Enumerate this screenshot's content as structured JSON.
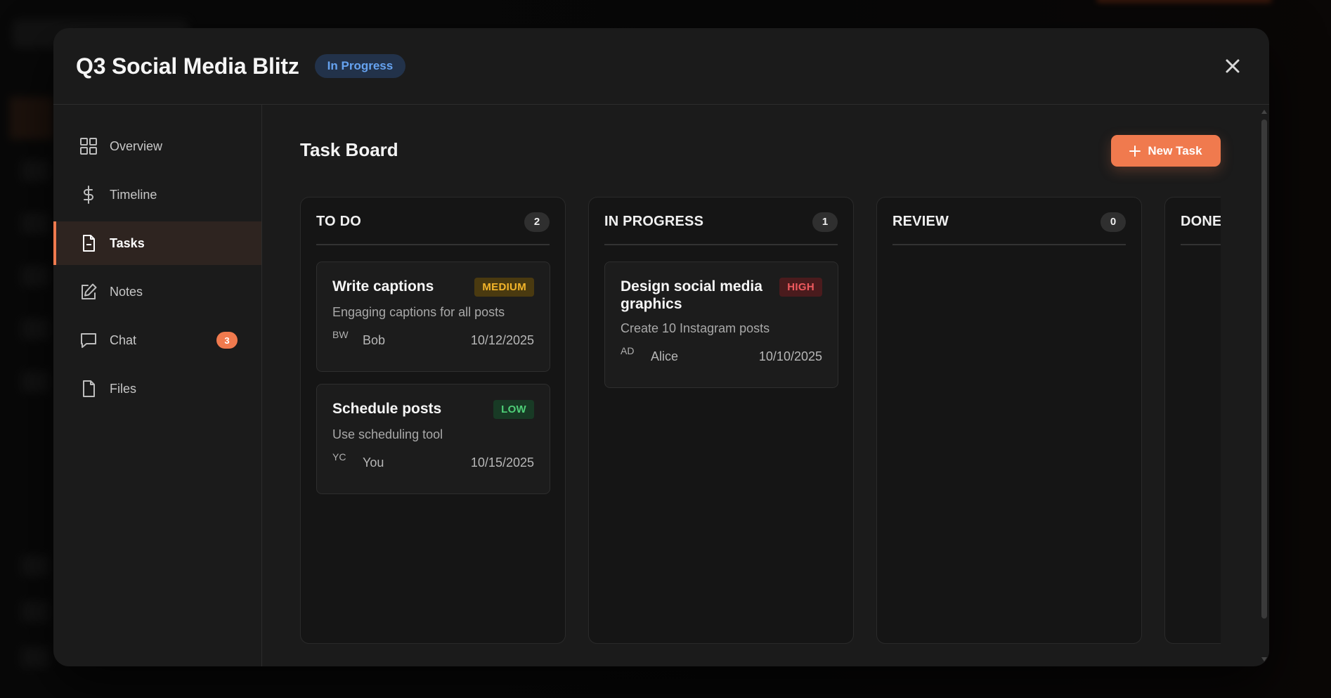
{
  "modal": {
    "title": "Q3 Social Media Blitz",
    "status": "In Progress",
    "close_icon": "close-icon"
  },
  "sidebar": {
    "items": [
      {
        "id": "overview",
        "label": "Overview",
        "icon": "grid-icon"
      },
      {
        "id": "timeline",
        "label": "Timeline",
        "icon": "dollar-icon"
      },
      {
        "id": "tasks",
        "label": "Tasks",
        "icon": "document-icon",
        "active": true
      },
      {
        "id": "notes",
        "label": "Notes",
        "icon": "edit-icon"
      },
      {
        "id": "chat",
        "label": "Chat",
        "icon": "chat-icon",
        "badge": "3"
      },
      {
        "id": "files",
        "label": "Files",
        "icon": "file-icon"
      }
    ]
  },
  "board": {
    "title": "Task Board",
    "new_task_label": "New Task",
    "columns": [
      {
        "title": "TO DO",
        "count": "2",
        "cards": [
          {
            "title": "Write captions",
            "priority": "MEDIUM",
            "description": "Engaging captions for all posts",
            "avatar": "BW",
            "assignee": "Bob",
            "due": "10/12/2025"
          },
          {
            "title": "Schedule posts",
            "priority": "LOW",
            "description": "Use scheduling tool",
            "avatar": "YC",
            "assignee": "You",
            "due": "10/15/2025"
          }
        ]
      },
      {
        "title": "IN PROGRESS",
        "count": "1",
        "cards": [
          {
            "title": "Design social media graphics",
            "priority": "HIGH",
            "description": "Create 10 Instagram posts",
            "avatar": "AD",
            "assignee": "Alice",
            "due": "10/10/2025"
          }
        ]
      },
      {
        "title": "REVIEW",
        "count": "0",
        "cards": []
      },
      {
        "title": "DONE",
        "count": "",
        "cards": []
      }
    ]
  },
  "colors": {
    "accent": "#f07a4e",
    "status_pill_bg": "#22324a",
    "status_pill_text": "#66a3f0",
    "medium": "#f3b52a",
    "low": "#4fcf78",
    "high": "#ef5a5e"
  }
}
